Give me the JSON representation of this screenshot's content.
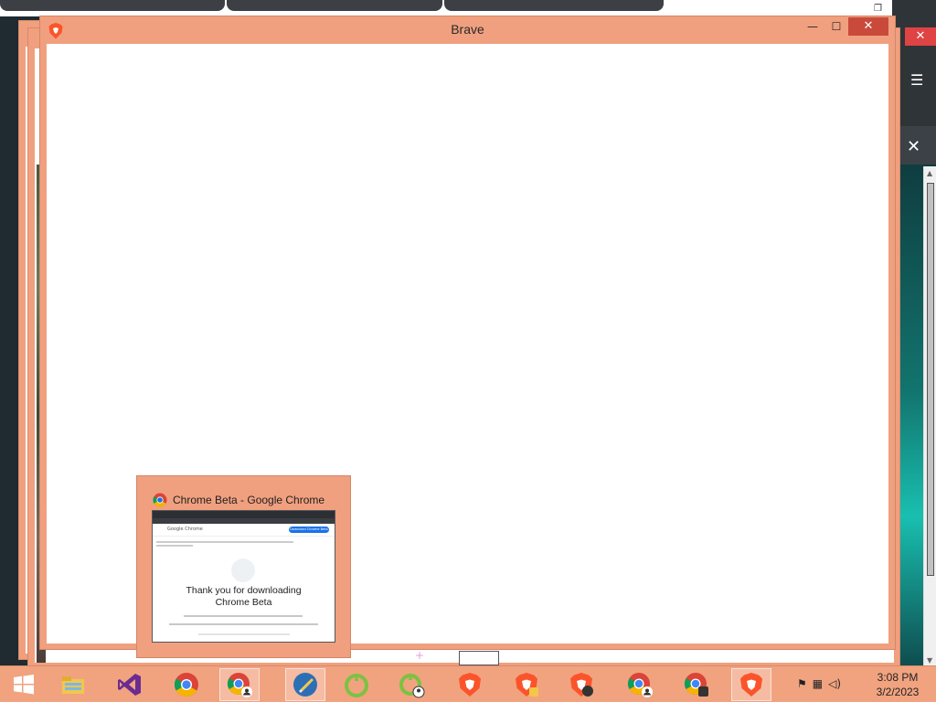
{
  "main_window": {
    "title": "Brave",
    "min_glyph": "—",
    "max_glyph": "☐",
    "close_glyph": "✕"
  },
  "background_window": {
    "close_glyph": "✕",
    "menu_glyph": "☰"
  },
  "preview": {
    "window_title": "Chrome Beta - Google Chrome",
    "thumb_brand": "Google Chrome",
    "thumb_download_button": "Download Chrome Beta",
    "thumb_heading_line1": "Thank you for downloading",
    "thumb_heading_line2": "Chrome Beta"
  },
  "taskbar": {
    "apps": [
      {
        "name": "file-explorer",
        "icon": "folder-icon",
        "active": false
      },
      {
        "name": "visual-studio",
        "icon": "visual-studio-icon",
        "active": false
      },
      {
        "name": "chrome",
        "icon": "chrome-icon",
        "active": false
      },
      {
        "name": "chrome-beta-profile",
        "icon": "chrome-profile-icon",
        "active": true
      },
      {
        "name": "tools",
        "icon": "tools-icon",
        "active": true
      },
      {
        "name": "app-green-1",
        "icon": "green-app-icon",
        "active": false
      },
      {
        "name": "app-green-2",
        "icon": "green-app-profile-icon",
        "active": false
      },
      {
        "name": "brave-1",
        "icon": "brave-icon",
        "active": false
      },
      {
        "name": "brave-2",
        "icon": "brave-beta-icon",
        "active": false
      },
      {
        "name": "brave-3",
        "icon": "brave-nightly-icon",
        "active": false
      },
      {
        "name": "chrome-profile-2",
        "icon": "chrome-profile-icon",
        "active": false
      },
      {
        "name": "chrome-profile-3",
        "icon": "chrome-profile-icon",
        "active": false
      },
      {
        "name": "brave-4",
        "icon": "brave-icon",
        "active": true
      }
    ],
    "clock_time": "3:08 PM",
    "clock_date": "3/2/2023"
  },
  "colors": {
    "accent": "#f0a07f",
    "close_red": "#c94a3b",
    "brave_orange": "#fb542b"
  }
}
